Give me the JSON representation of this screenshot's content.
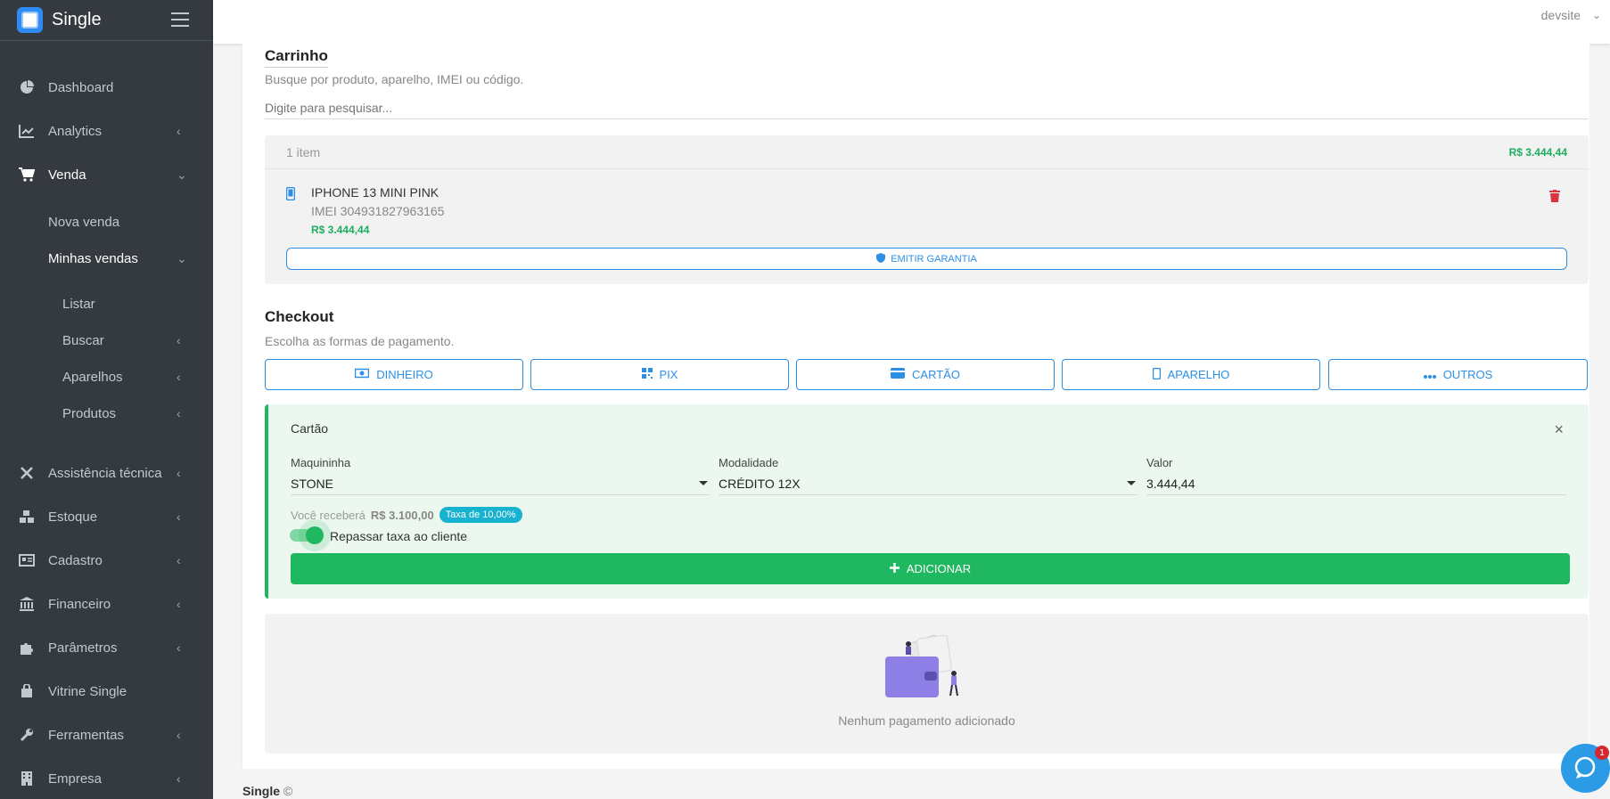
{
  "brand": {
    "name": "Single"
  },
  "topbar": {
    "user": "devsite"
  },
  "sidebar": {
    "items": [
      {
        "label": "Dashboard"
      },
      {
        "label": "Analytics"
      },
      {
        "label": "Venda"
      },
      {
        "label": "Nova venda"
      },
      {
        "label": "Minhas vendas"
      },
      {
        "label": "Listar"
      },
      {
        "label": "Buscar"
      },
      {
        "label": "Aparelhos"
      },
      {
        "label": "Produtos"
      },
      {
        "label": "Assistência técnica"
      },
      {
        "label": "Estoque"
      },
      {
        "label": "Cadastro"
      },
      {
        "label": "Financeiro"
      },
      {
        "label": "Parâmetros"
      },
      {
        "label": "Vitrine Single"
      },
      {
        "label": "Ferramentas"
      },
      {
        "label": "Empresa"
      }
    ]
  },
  "cart": {
    "title": "Carrinho",
    "subtitle": "Busque por produto, aparelho, IMEI ou código.",
    "search_placeholder": "Digite para pesquisar...",
    "count": "1 item",
    "total": "R$ 3.444,44",
    "item": {
      "name": "IPHONE 13 MINI PINK",
      "imei": "IMEI 304931827963165",
      "price": "R$ 3.444,44",
      "warranty_label": "EMITIR GARANTIA"
    }
  },
  "checkout": {
    "title": "Checkout",
    "subtitle": "Escolha as formas de pagamento.",
    "methods": [
      {
        "label": "DINHEIRO",
        "icon": "cash-icon"
      },
      {
        "label": "PIX",
        "icon": "pix-icon"
      },
      {
        "label": "CARTÃO",
        "icon": "credit-card-icon"
      },
      {
        "label": "APARELHO",
        "icon": "phone-icon"
      },
      {
        "label": "OUTROS",
        "icon": "more-icon"
      }
    ],
    "card": {
      "title": "Cartão",
      "machine_label": "Maquininha",
      "machine_value": "STONE",
      "mode_label": "Modalidade",
      "mode_value": "CRÉDITO 12X",
      "value_label": "Valor",
      "value": "3.444,44",
      "receive_prefix": "Você receberá",
      "receive_value": "R$ 3.100,00",
      "fee_badge": "Taxa de 10,00%",
      "toggle_label": "Repassar taxa ao cliente",
      "add_label": "ADICIONAR"
    },
    "empty_text": "Nenhum pagamento adicionado"
  },
  "footer": {
    "brand": "Single",
    "copyright": "©"
  },
  "chat": {
    "badge": "1"
  },
  "colors": {
    "accent": "#2c8fe6",
    "success": "#1fb760",
    "sidebar": "#343a40"
  }
}
